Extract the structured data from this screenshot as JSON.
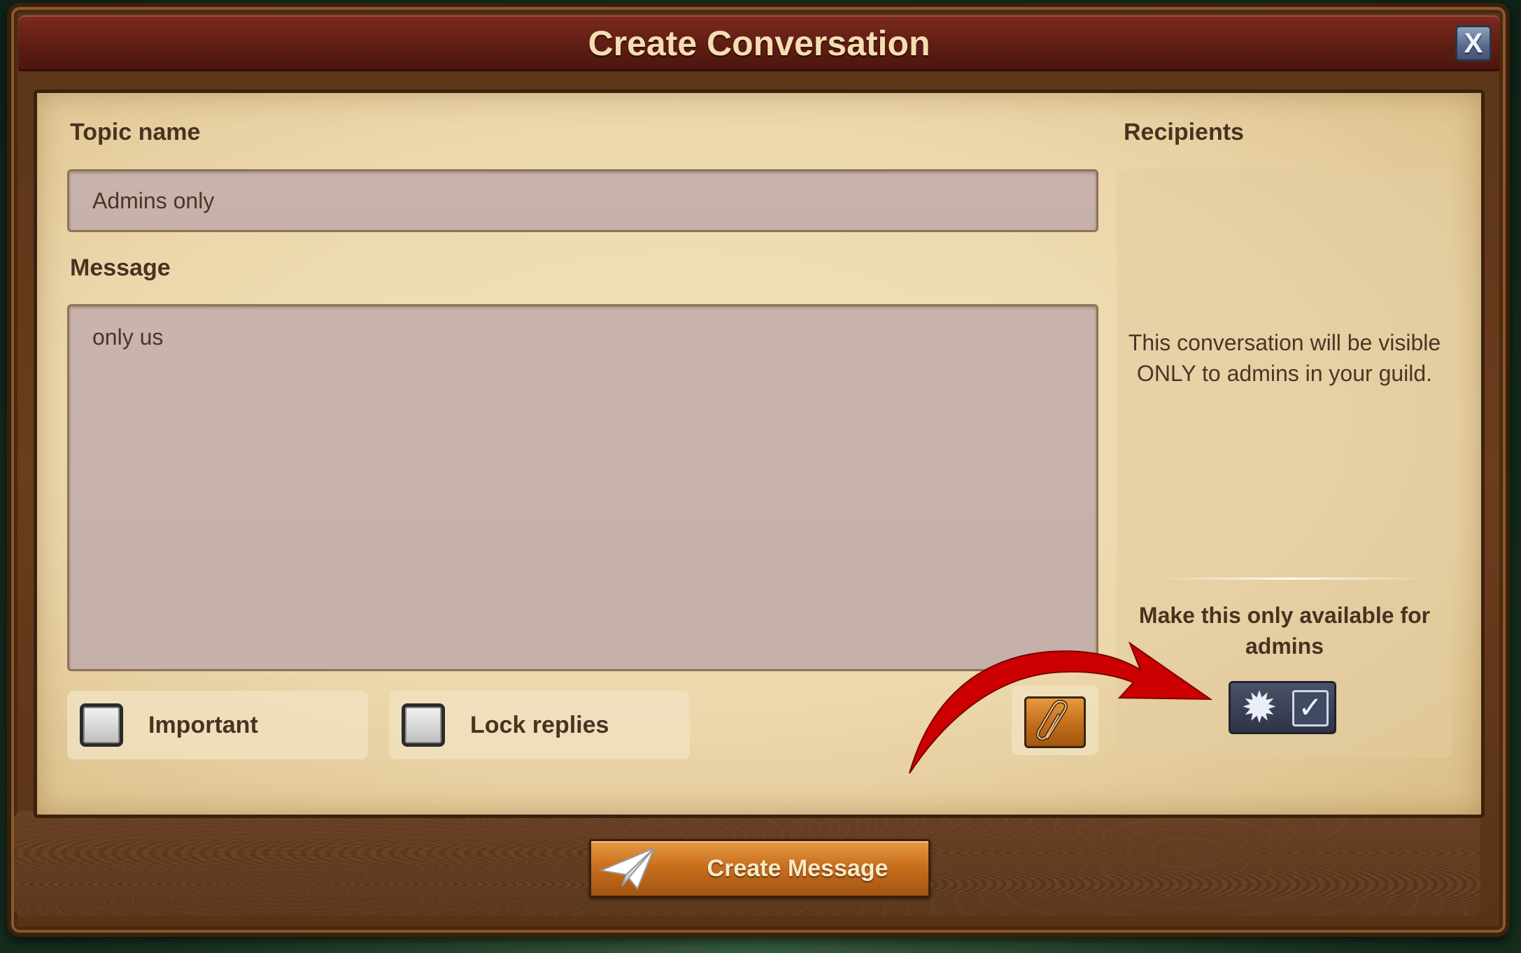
{
  "window": {
    "title": "Create Conversation",
    "close_label": "X"
  },
  "form": {
    "topic_label": "Topic name",
    "topic_value": "Admins only",
    "message_label": "Message",
    "message_value": "only us",
    "options": [
      {
        "label": "Important",
        "checked": false
      },
      {
        "label": "Lock replies",
        "checked": false
      }
    ],
    "attach_icon": "paperclip-icon"
  },
  "recipients": {
    "label": "Recipients",
    "info_text": "This conversation will be visible ONLY to admins in your guild.",
    "admin_only_label": "Make this only available for admins",
    "admin_only_checked": true,
    "admin_icon": "gear-star-icon"
  },
  "actions": {
    "create_label": "Create Message",
    "create_icon": "paper-plane-icon"
  },
  "annotation": {
    "arrow_color": "#cc0000"
  }
}
